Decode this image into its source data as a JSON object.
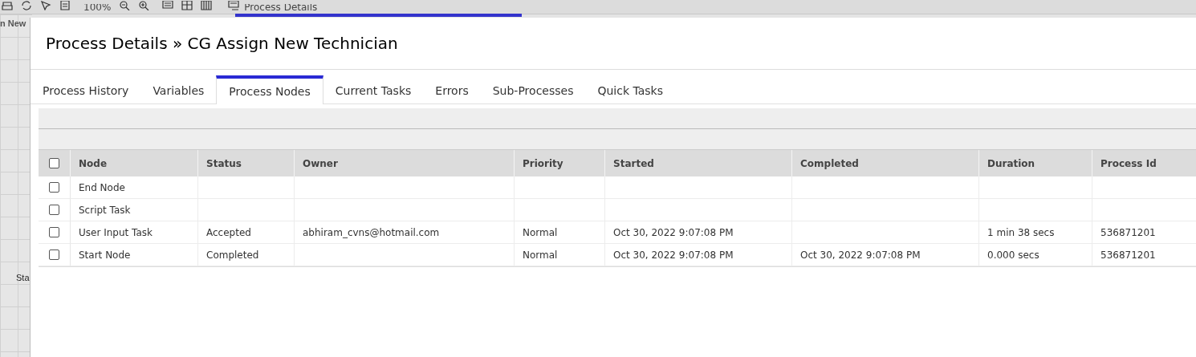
{
  "toolbar": {
    "zoom": "100%",
    "tab_title": "Process Details"
  },
  "background": {
    "canvas_title": "n New",
    "node_label": "Sta"
  },
  "dialog": {
    "title": "Process Details » CG Assign New Technician",
    "tabs": [
      {
        "label": "Process History",
        "selected": false
      },
      {
        "label": "Variables",
        "selected": false
      },
      {
        "label": "Process Nodes",
        "selected": true
      },
      {
        "label": "Current Tasks",
        "selected": false
      },
      {
        "label": "Errors",
        "selected": false
      },
      {
        "label": "Sub-Processes",
        "selected": false
      },
      {
        "label": "Quick Tasks",
        "selected": false
      }
    ],
    "table": {
      "select_all_checked": false,
      "columns": [
        "Node",
        "Status",
        "Owner",
        "Priority",
        "Started",
        "Completed",
        "Duration",
        "Process Id"
      ],
      "rows": [
        {
          "checked": false,
          "cells": [
            "End Node",
            "",
            "",
            "",
            "",
            "",
            "",
            ""
          ]
        },
        {
          "checked": false,
          "cells": [
            "Script Task",
            "",
            "",
            "",
            "",
            "",
            "",
            ""
          ]
        },
        {
          "checked": false,
          "cells": [
            "User Input Task",
            "Accepted",
            "abhiram_cvns@hotmail.com",
            "Normal",
            "Oct 30, 2022 9:07:08 PM",
            "",
            "1 min 38 secs",
            "536871201"
          ]
        },
        {
          "checked": false,
          "cells": [
            "Start Node",
            "Completed",
            "",
            "Normal",
            "Oct 30, 2022 9:07:08 PM",
            "Oct 30, 2022 9:07:08 PM",
            "0.000 secs",
            "536871201"
          ]
        }
      ]
    }
  }
}
